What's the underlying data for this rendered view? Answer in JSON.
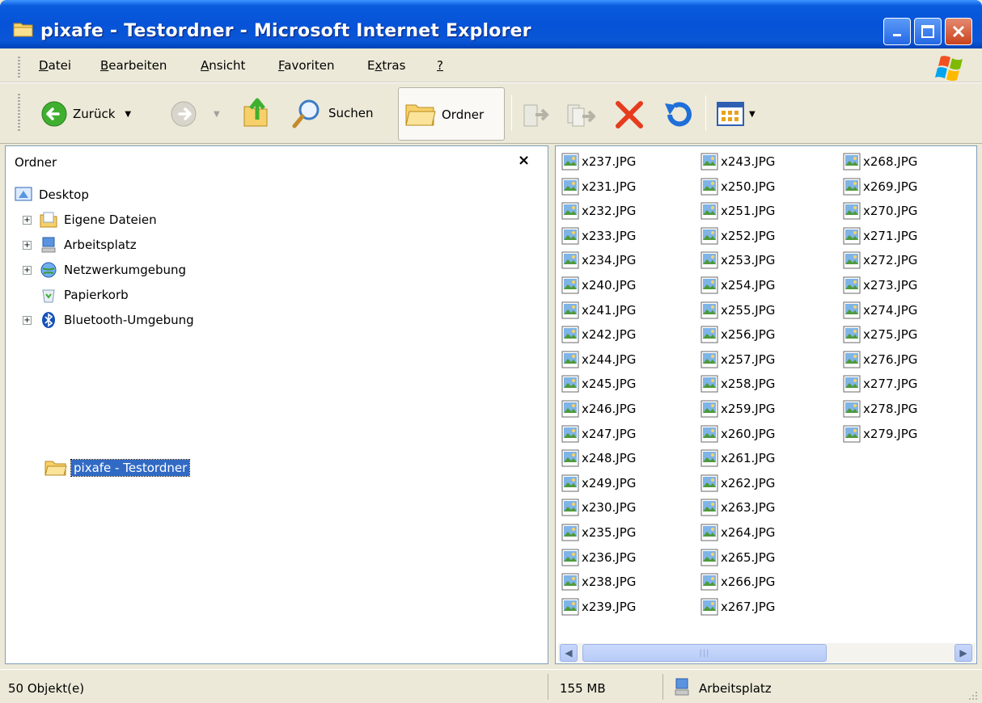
{
  "window": {
    "title": "pixafe - Testordner - Microsoft Internet Explorer"
  },
  "menu": {
    "items": [
      {
        "label": "Datei",
        "accel": "D"
      },
      {
        "label": "Bearbeiten",
        "accel": "B"
      },
      {
        "label": "Ansicht",
        "accel": "A"
      },
      {
        "label": "Favoriten",
        "accel": "F"
      },
      {
        "label": "Extras",
        "accel": "x"
      },
      {
        "label": "?",
        "accel": "?"
      }
    ]
  },
  "toolbar": {
    "back_label": "Zurück",
    "search_label": "Suchen",
    "folders_label": "Ordner"
  },
  "folder_pane": {
    "title": "Ordner",
    "close_glyph": "×",
    "tree": [
      {
        "label": "Desktop"
      },
      {
        "label": "Eigene Dateien"
      },
      {
        "label": "Arbeitsplatz"
      },
      {
        "label": "Netzwerkumgebung"
      },
      {
        "label": "Papierkorb"
      },
      {
        "label": "Bluetooth-Umgebung"
      },
      {
        "label": "pixafe - Testordner"
      }
    ]
  },
  "files": {
    "col1": [
      "x237.JPG",
      "x231.JPG",
      "x232.JPG",
      "x233.JPG",
      "x234.JPG",
      "x240.JPG",
      "x241.JPG",
      "x242.JPG",
      "x244.JPG",
      "x245.JPG",
      "x246.JPG",
      "x247.JPG",
      "x248.JPG",
      "x249.JPG",
      "x230.JPG",
      "x235.JPG",
      "x236.JPG",
      "x238.JPG",
      "x239.JPG"
    ],
    "col2": [
      "x243.JPG",
      "x250.JPG",
      "x251.JPG",
      "x252.JPG",
      "x253.JPG",
      "x254.JPG",
      "x255.JPG",
      "x256.JPG",
      "x257.JPG",
      "x258.JPG",
      "x259.JPG",
      "x260.JPG",
      "x261.JPG",
      "x262.JPG",
      "x263.JPG",
      "x264.JPG",
      "x265.JPG",
      "x266.JPG",
      "x267.JPG"
    ],
    "col3": [
      "x268.JPG",
      "x269.JPG",
      "x270.JPG",
      "x271.JPG",
      "x272.JPG",
      "x273.JPG",
      "x274.JPG",
      "x275.JPG",
      "x276.JPG",
      "x277.JPG",
      "x278.JPG",
      "x279.JPG"
    ]
  },
  "status": {
    "objects": "50 Objekt(e)",
    "size": "155 MB",
    "location": "Arbeitsplatz"
  }
}
